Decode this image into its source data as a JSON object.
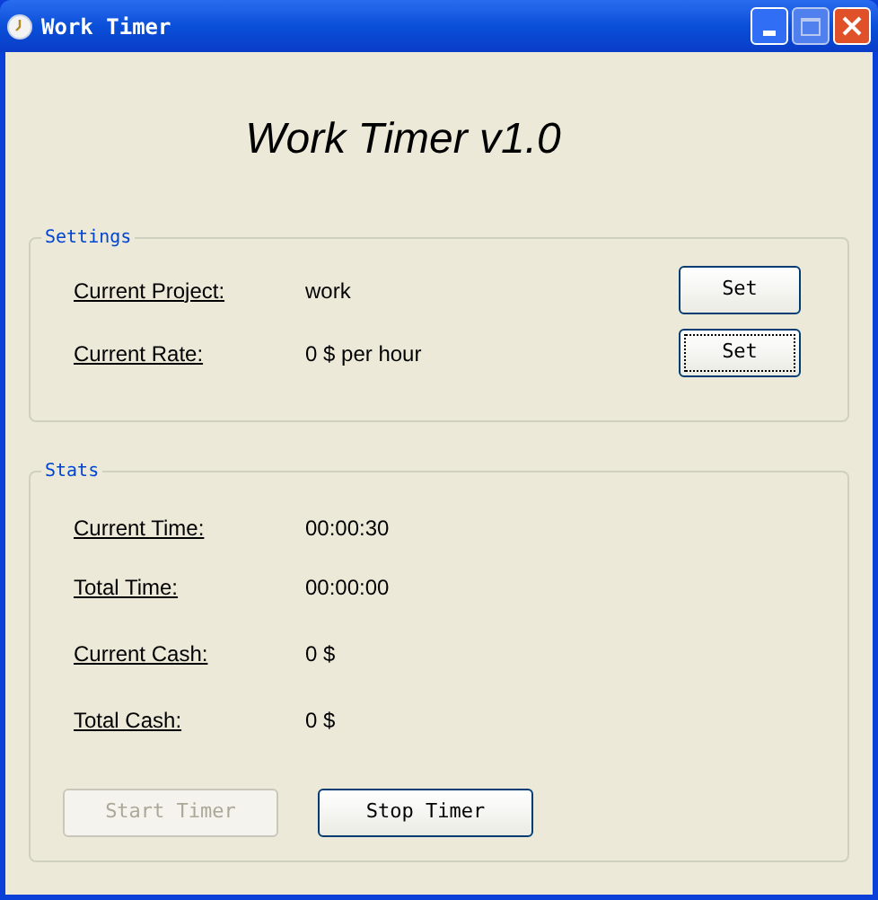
{
  "window": {
    "title": "Work Timer"
  },
  "heading": "Work Timer v1.0",
  "settings": {
    "title": "Settings",
    "rows": [
      {
        "label": "Current Project:",
        "value": "work",
        "button": {
          "label": "Set",
          "focused": false
        }
      },
      {
        "label": "Current Rate:",
        "value": "0 $ per hour",
        "button": {
          "label": "Set",
          "focused": true
        }
      }
    ]
  },
  "stats": {
    "title": "Stats",
    "rows": [
      {
        "label": "Current Time:",
        "value": "00:00:30"
      },
      {
        "label": "Total Time:",
        "value": "00:00:00"
      },
      {
        "label": "Current Cash:",
        "value": "0 $"
      },
      {
        "label": "Total Cash:",
        "value": "0 $"
      }
    ]
  },
  "buttons": [
    {
      "label": "Start Timer",
      "disabled": true
    },
    {
      "label": "Stop Timer",
      "disabled": false
    }
  ]
}
